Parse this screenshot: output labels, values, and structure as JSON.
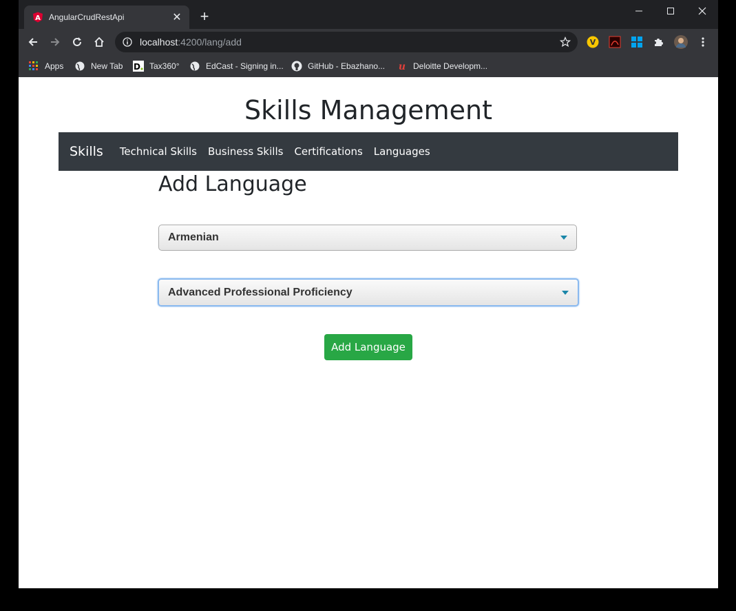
{
  "browser": {
    "tab_title": "AngularCrudRestApi",
    "url_host": "localhost",
    "url_rest": ":4200/lang/add",
    "bookmarks": [
      {
        "label": "Apps"
      },
      {
        "label": "New Tab"
      },
      {
        "label": "Tax360°"
      },
      {
        "label": "EdCast - Signing in..."
      },
      {
        "label": "GitHub - Ebazhano..."
      },
      {
        "label": "Deloitte Developm..."
      }
    ]
  },
  "page": {
    "title": "Skills Management",
    "nav": {
      "brand": "Skills",
      "links": [
        "Technical Skills",
        "Business Skills",
        "Certifications",
        "Languages"
      ]
    },
    "form": {
      "heading": "Add Language",
      "language_select": "Armenian",
      "proficiency_select": "Advanced Professional Proficiency",
      "submit_label": "Add Language"
    }
  },
  "colors": {
    "navbar_bg": "#343a40",
    "button_green": "#28a745",
    "chrome_dark": "#202124",
    "chrome_toolbar": "#35363a"
  }
}
